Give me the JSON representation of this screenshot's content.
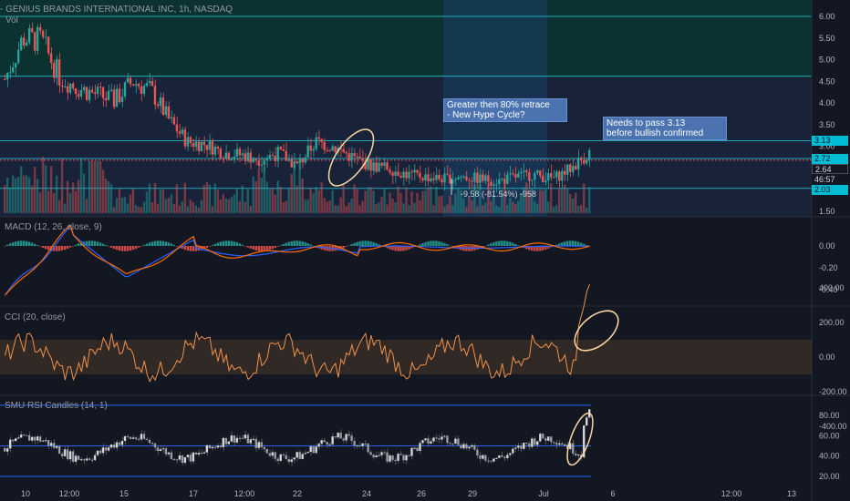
{
  "header": {
    "title": "- GENIUS BRANDS INTERNATIONAL INC, 1h, NASDAQ",
    "vol_label": "Vol"
  },
  "annotations": {
    "retrace": "Greater then 80% retrace\n- New Hype Cycle?",
    "bullish": "Needs to pass 3.13\nbefore bullish confirmed",
    "measure": "-9.58 (-81.54%) -958"
  },
  "price_tags": {
    "t1": "3.13",
    "t2": "2.72",
    "t3": "2.64",
    "t4": "46:57",
    "t5": "2.03",
    "hidden": "3.00"
  },
  "colors": {
    "up": "#26a69a",
    "down": "#ef5350",
    "macd": "#2962ff",
    "signal": "#ff6d00",
    "cci": "#f0904a",
    "rsi_band": "#2962ff",
    "bg": "#131722",
    "highlight_ellipse": "#ffd8a0"
  },
  "chart_data": [
    {
      "type": "candlestick",
      "name": "price",
      "title": "GENIUS BRANDS INTERNATIONAL INC, 1h, NASDAQ",
      "yticks": [
        "6.00",
        "5.50",
        "5.00",
        "4.50",
        "4.00",
        "3.50",
        "3.00",
        "2.50",
        "2.00",
        "1.50"
      ],
      "ylim": [
        1.5,
        6.0
      ],
      "xticks": [
        "10",
        "12:00",
        "15",
        "17",
        "12:00",
        "22",
        "24",
        "26",
        "29",
        "Jul",
        "6",
        "12:00",
        "13"
      ],
      "levels": [
        6.0,
        4.62,
        3.13,
        2.72,
        2.03
      ],
      "close": [
        4.55,
        5.5,
        5.45,
        4.6,
        4.35,
        4.2,
        4.05,
        4.5,
        4.3,
        3.6,
        3.1,
        3.05,
        2.85,
        2.8,
        2.7,
        2.85,
        2.55,
        3.1,
        3.0,
        2.75,
        2.55,
        2.5,
        2.35,
        2.3,
        2.25,
        2.3,
        2.25,
        2.2,
        2.3,
        2.35,
        2.25,
        2.5,
        2.85
      ],
      "series_source": "hourly candles, approx. read from chart"
    },
    {
      "type": "line",
      "name": "MACD",
      "label": "MACD (12, 26, close, 9)",
      "yticks": [
        "0.00",
        "-0.20",
        "-0.40"
      ],
      "ylim": [
        -0.5,
        0.1
      ]
    },
    {
      "type": "line",
      "name": "CCI",
      "label": "CCI (20, close)",
      "yticks": [
        "400.00",
        "200.00",
        "0.00",
        "-200.00",
        "-400.00"
      ],
      "ylim": [
        -420,
        420
      ]
    },
    {
      "type": "candlestick",
      "name": "RSI",
      "label": "SMU RSI Candles (14, 1)",
      "yticks": [
        "80.00",
        "60.00",
        "40.00",
        "20.00"
      ],
      "levels": [
        90,
        50,
        20
      ],
      "ylim": [
        15,
        95
      ]
    }
  ]
}
